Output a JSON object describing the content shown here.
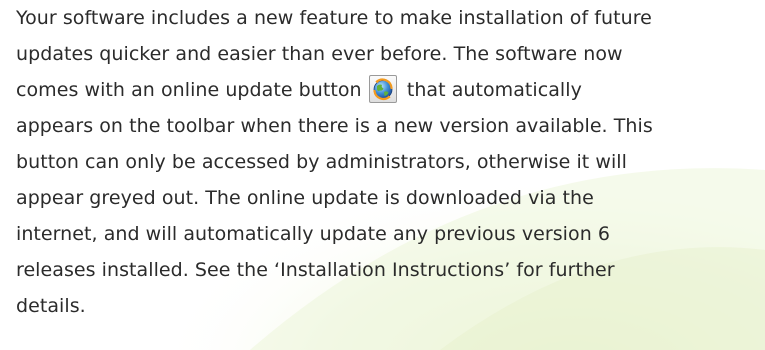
{
  "paragraph": {
    "lines": [
      "Your software includes a new feature to make installation of future",
      "updates quicker and easier than ever before. The software now",
      "comes with an online update button",
      "that automatically",
      "appears on the toolbar when there is a new version available. This",
      "button can only be accessed by administrators, otherwise it will",
      "appear greyed out. The online update is downloaded via the",
      "internet, and will automatically update any previous version 6",
      "releases installed. See the ‘Installation Instructions’ for further",
      "details."
    ]
  },
  "icons": {
    "update_button": "online-update-globe-icon"
  },
  "colors": {
    "text": "#2b2b2b",
    "background_wash": "#eef6d9"
  }
}
